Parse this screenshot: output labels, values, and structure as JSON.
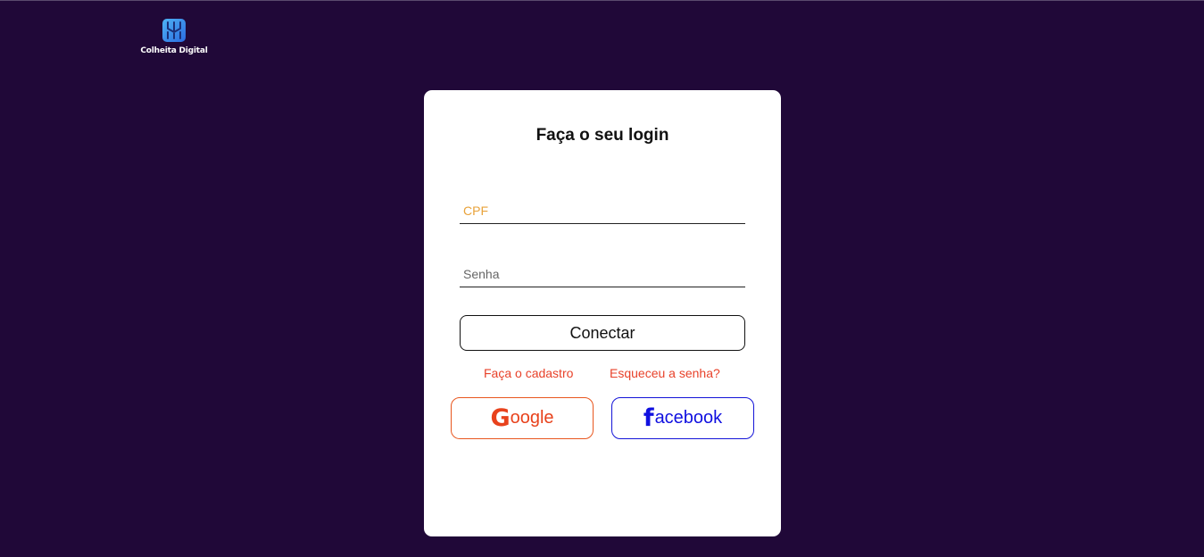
{
  "brand": {
    "name": "Colheita Digital",
    "logo_color_from": "#3aa0f0",
    "logo_color_to": "#1e5fd8"
  },
  "login": {
    "title": "Faça o seu login",
    "cpf_placeholder": "CPF",
    "password_placeholder": "Senha",
    "connect_label": "Conectar",
    "signup_link": "Faça o cadastro",
    "forgot_link": "Esqueceu a senha?"
  },
  "social": {
    "google": {
      "icon": "google-g-icon",
      "icon_glyph": "G",
      "label": "oogle",
      "color": "#e8421c"
    },
    "facebook": {
      "icon": "facebook-f-icon",
      "icon_glyph": "f",
      "label": "acebook",
      "color": "#1010e0"
    }
  },
  "colors": {
    "background": "#200838",
    "card": "#ffffff",
    "link": "#e8422a",
    "cpf_placeholder": "#e8a23a"
  }
}
